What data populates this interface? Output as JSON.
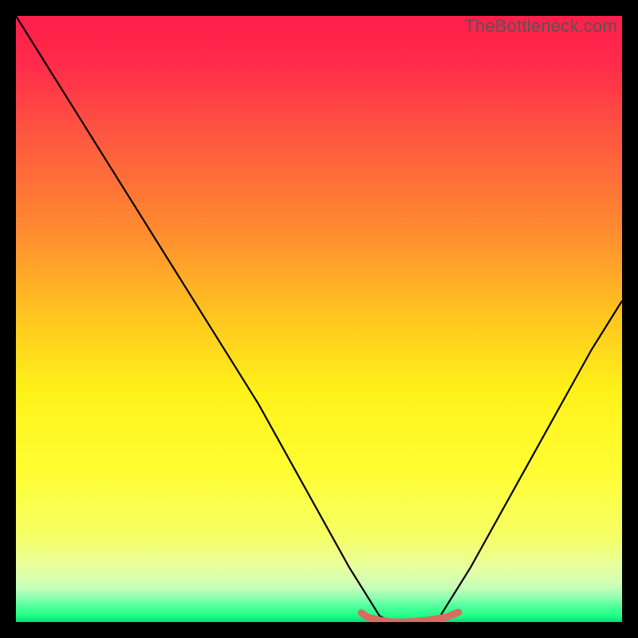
{
  "watermark": "TheBottleneck.com",
  "chart_data": {
    "type": "line",
    "title": "",
    "xlabel": "",
    "ylabel": "",
    "xlim": [
      0,
      100
    ],
    "ylim": [
      0,
      100
    ],
    "series": [
      {
        "name": "bottleneck-curve",
        "x": [
          0,
          5,
          10,
          15,
          20,
          25,
          30,
          35,
          40,
          45,
          50,
          55,
          60,
          62,
          65,
          70,
          75,
          80,
          85,
          90,
          95,
          100
        ],
        "values": [
          100,
          92,
          84,
          76,
          68,
          60,
          52,
          44,
          36,
          27,
          18,
          9,
          1,
          0,
          0,
          1,
          9,
          18,
          27,
          36,
          45,
          53
        ]
      },
      {
        "name": "optimal-band",
        "x": [
          57,
          58,
          60,
          62,
          65,
          68,
          71,
          72,
          73
        ],
        "values": [
          1.5,
          0.8,
          0.3,
          0.0,
          0.0,
          0.3,
          0.8,
          1.2,
          1.6
        ]
      }
    ],
    "gradient_stops": [
      {
        "offset": 0.0,
        "color": "#ff1f4b"
      },
      {
        "offset": 0.08,
        "color": "#ff2b4a"
      },
      {
        "offset": 0.2,
        "color": "#ff5840"
      },
      {
        "offset": 0.35,
        "color": "#ff8a30"
      },
      {
        "offset": 0.5,
        "color": "#ffc71f"
      },
      {
        "offset": 0.62,
        "color": "#fff21a"
      },
      {
        "offset": 0.75,
        "color": "#fffd33"
      },
      {
        "offset": 0.86,
        "color": "#f6ff66"
      },
      {
        "offset": 0.91,
        "color": "#e8ffa0"
      },
      {
        "offset": 0.942,
        "color": "#c8ffb8"
      },
      {
        "offset": 0.96,
        "color": "#8dffb0"
      },
      {
        "offset": 0.975,
        "color": "#4dff9a"
      },
      {
        "offset": 0.99,
        "color": "#1eff86"
      },
      {
        "offset": 1.0,
        "color": "#0dd873"
      }
    ],
    "optimal_color": "#d96c62",
    "curve_color": "#000000"
  }
}
